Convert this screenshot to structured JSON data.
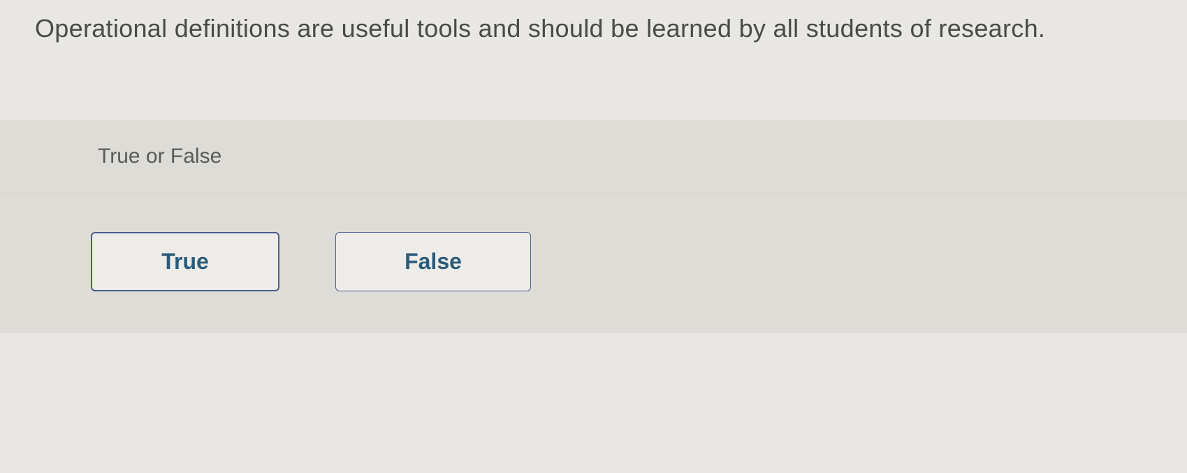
{
  "question": {
    "text": "Operational definitions are useful tools and should be learned by all students of research."
  },
  "answer": {
    "prompt": "True or False",
    "options": [
      {
        "label": "True"
      },
      {
        "label": "False"
      }
    ]
  }
}
